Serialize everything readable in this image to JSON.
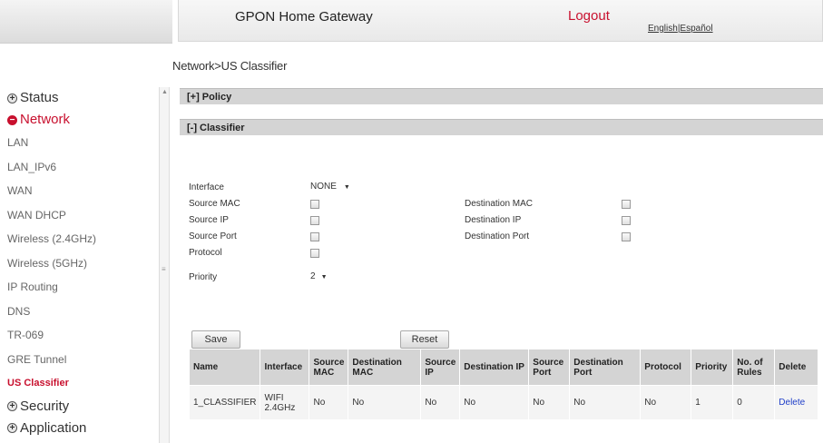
{
  "header": {
    "title": "GPON Home Gateway",
    "logout": "Logout",
    "lang_english": "English",
    "lang_separator": "|",
    "lang_spanish": "Español"
  },
  "breadcrumb": "Network>US Classifier",
  "sidebar": {
    "status": "Status",
    "network": "Network",
    "items": [
      "LAN",
      "LAN_IPv6",
      "WAN",
      "WAN DHCP",
      "Wireless (2.4GHz)",
      "Wireless (5GHz)",
      "IP Routing",
      "DNS",
      "TR-069",
      "GRE Tunnel",
      "US Classifier"
    ],
    "security": "Security",
    "application": "Application"
  },
  "sections": {
    "policy": "[+] Policy",
    "classifier": "[-] Classifier"
  },
  "form": {
    "interface_label": "Interface",
    "interface_value": "NONE",
    "source_mac": "Source MAC",
    "source_ip": "Source IP",
    "source_port": "Source Port",
    "protocol": "Protocol",
    "priority_label": "Priority",
    "priority_value": "2",
    "dest_mac": "Destination MAC",
    "dest_ip": "Destination IP",
    "dest_port": "Destination Port",
    "save": "Save",
    "reset": "Reset"
  },
  "table": {
    "headers": {
      "name": "Name",
      "interface": "Interface",
      "source_mac": "Source MAC",
      "dest_mac": "Destination MAC",
      "source_ip": "Source IP",
      "dest_ip": "Destination IP",
      "source_port": "Source Port",
      "dest_port": "Destination Port",
      "protocol": "Protocol",
      "priority": "Priority",
      "no_rules": "No. of Rules",
      "delete": "Delete"
    },
    "rows": [
      {
        "name": "1_CLASSIFIER",
        "interface": "WIFI 2.4GHz",
        "source_mac": "No",
        "dest_mac": "No",
        "source_ip": "No",
        "dest_ip": "No",
        "source_port": "No",
        "dest_port": "No",
        "protocol": "No",
        "priority": "1",
        "no_rules": "0",
        "delete": "Delete"
      }
    ]
  }
}
